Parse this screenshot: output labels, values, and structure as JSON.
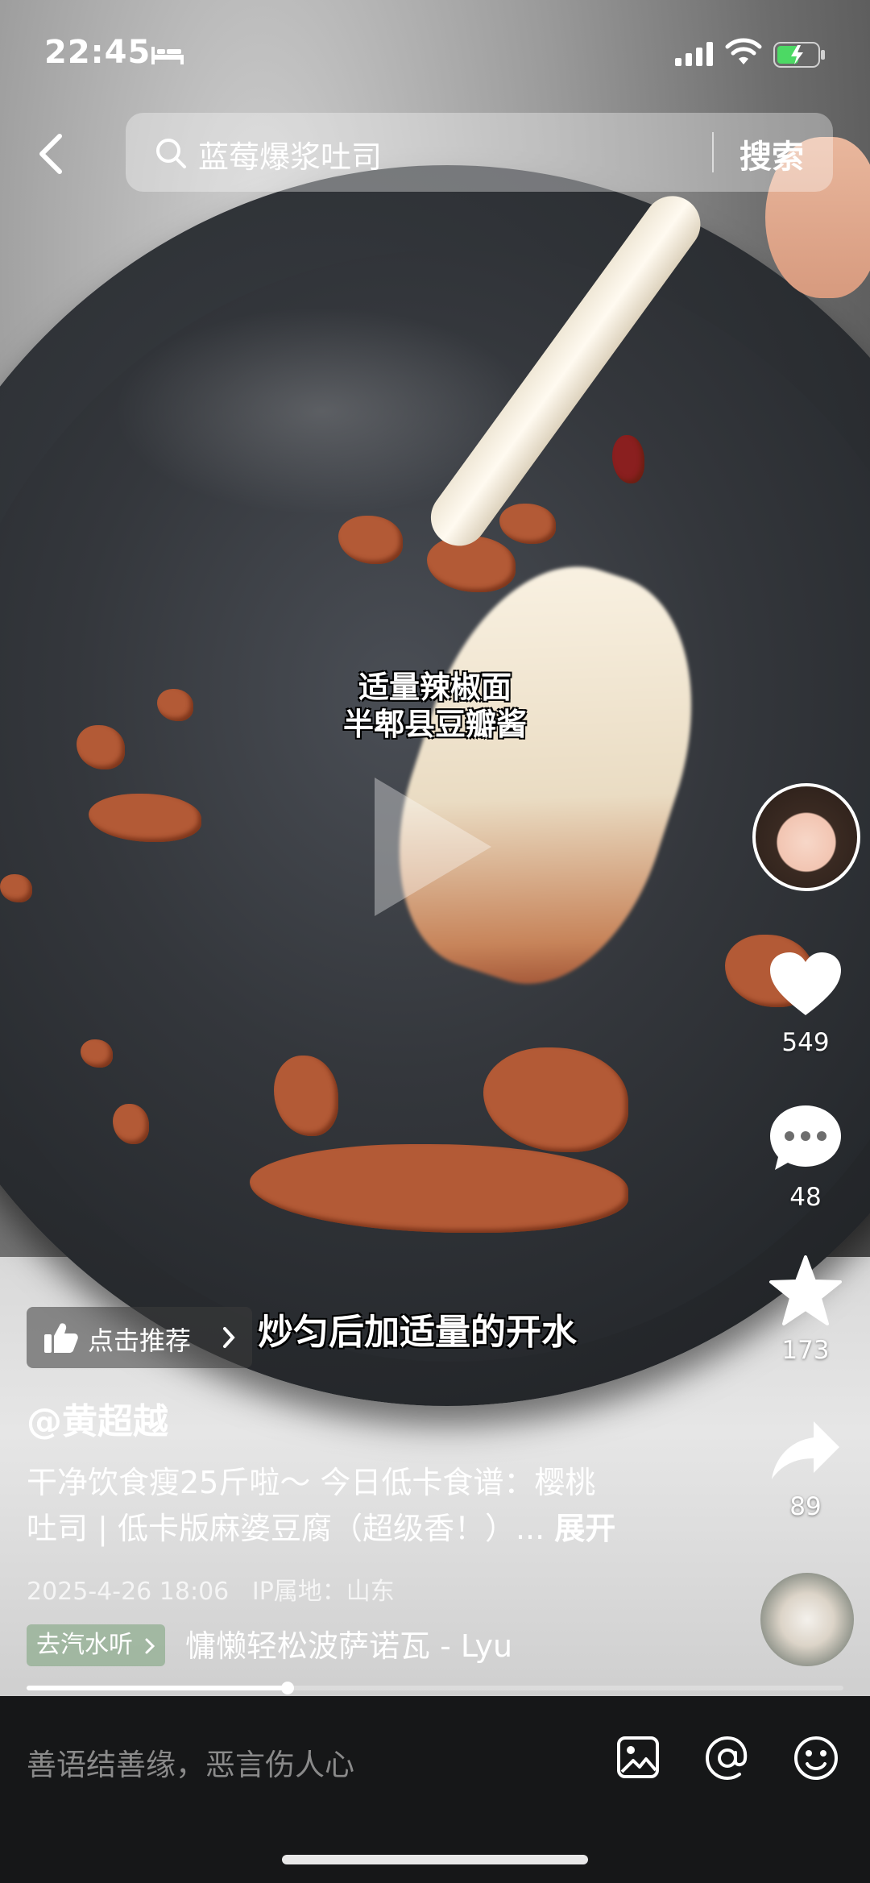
{
  "status_bar": {
    "time": "22:45"
  },
  "search": {
    "query": "蓝莓爆浆吐司",
    "button": "搜索"
  },
  "video": {
    "caption_top_line1": "适量辣椒面",
    "caption_top_line2": "半郫县豆瓣酱",
    "caption_bottom": "炒匀后加适量的开水",
    "progress": 0.32
  },
  "actions": {
    "likes": "549",
    "comments": "48",
    "favorites": "173",
    "shares": "89"
  },
  "recommend": {
    "label": "点击推荐"
  },
  "post": {
    "author": "@黄超越",
    "description_line1": "干净饮食瘦25斤啦～ 今日低卡食谱：樱桃",
    "description_line2": "吐司 | 低卡版麻婆豆腐（超级香！）...",
    "expand": "展开",
    "date": "2025-4-26 18:06",
    "ip": "IP属地：山东"
  },
  "music": {
    "tag": "去汽水听",
    "title": "慵懒轻松波萨诺瓦 - Lyu"
  },
  "comment_bar": {
    "placeholder": "善语结善缘，恶言伤人心"
  },
  "icons": [
    "bed-icon",
    "signal-icon",
    "wifi-icon",
    "battery-icon",
    "back-icon",
    "search-icon",
    "play-icon",
    "heart-icon",
    "comment-icon",
    "star-icon",
    "share-icon",
    "thumb-up-icon",
    "image-icon",
    "at-icon",
    "emoji-icon"
  ]
}
